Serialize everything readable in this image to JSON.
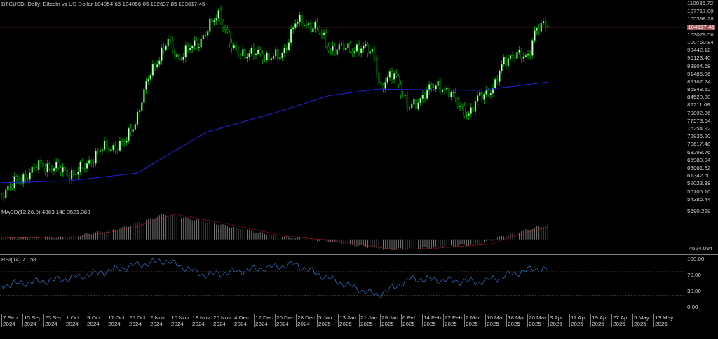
{
  "chart": {
    "title": "BTCUSD, Daily:  Bitcoin vs US Dollar  104054.65 104056.05 102637.85 103617.45",
    "current_price": "104617.45"
  },
  "price_axis": {
    "labels": [
      "110035.72",
      "107717.00",
      "105398.28",
      "103079.56",
      "100760.84",
      "98442.12",
      "96123.40",
      "93804.68",
      "91485.96",
      "89167.24",
      "86848.52",
      "84529.80",
      "82211.08",
      "79892.36",
      "77573.64",
      "75254.92",
      "72936.20",
      "70617.48",
      "68298.76",
      "65980.04",
      "63661.32",
      "61342.60",
      "59023.88",
      "56705.16",
      "54386.44"
    ]
  },
  "macd": {
    "label": "MACD(12,26,9) 4863.148 3521.363",
    "axis_labels": [
      "5690.299",
      "-4624.094"
    ]
  },
  "rsi": {
    "label": "RSI(14) 71.58",
    "axis_labels": [
      "100.00",
      "70.00",
      "30.00",
      "0.00"
    ]
  },
  "date_axis": {
    "labels": [
      "7 Sep 2024",
      "15 Sep 2024",
      "23 Sep 2024",
      "1 Oct 2024",
      "9 Oct 2024",
      "17 Oct 2024",
      "25 Oct 2024",
      "2 Nov 2024",
      "10 Nov 2024",
      "18 Nov 2024",
      "26 Nov 2024",
      "4 Dec 2024",
      "12 Dec 2024",
      "20 Dec 2024",
      "28 Dec 2024",
      "5 Jan 2025",
      "13 Jan 2025",
      "21 Jan 2025",
      "29 Jan 2025",
      "6 Feb 2025",
      "14 Feb 2025",
      "22 Feb 2025",
      "2 Mar 2025",
      "10 Mar 2025",
      "18 Mar 2025",
      "26 Mar 2025",
      "3 Apr 2025",
      "11 Apr 2025",
      "19 Apr 2025",
      "27 Apr 2025",
      "5 May 2025",
      "13 May 2025"
    ]
  }
}
